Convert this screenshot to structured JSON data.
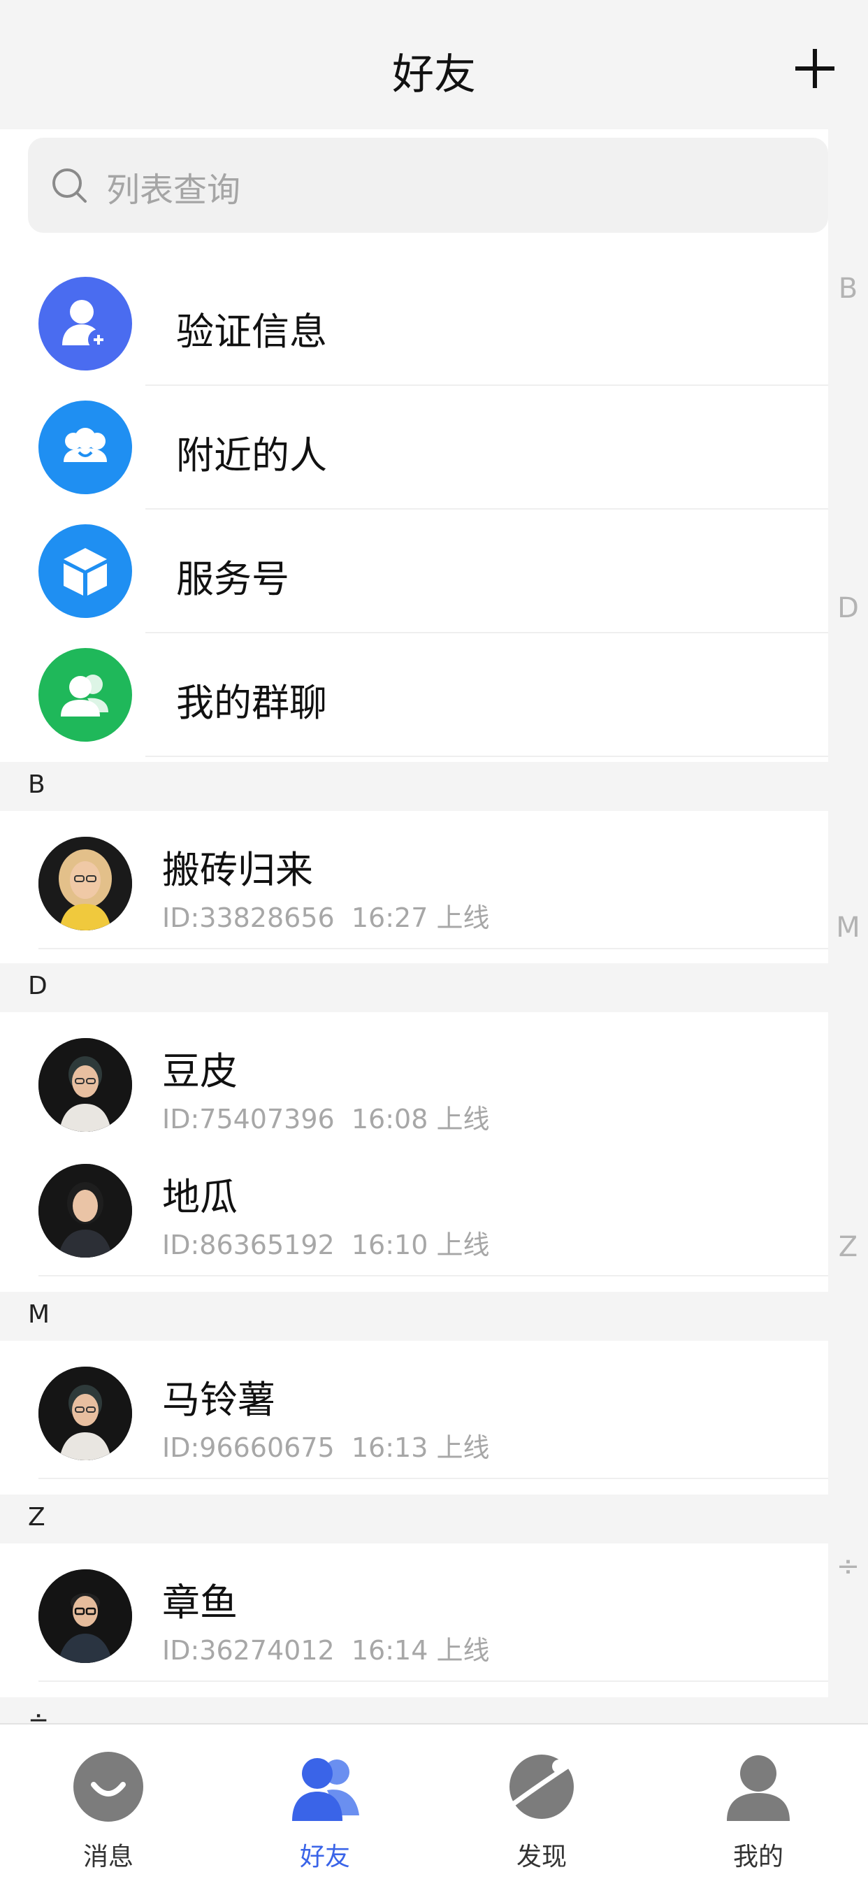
{
  "header": {
    "title": "好友"
  },
  "search": {
    "placeholder": "列表查询"
  },
  "functions": [
    {
      "label": "验证信息",
      "icon": "add-user-icon",
      "color": "#4a6cf0"
    },
    {
      "label": "附近的人",
      "icon": "nearby-people-icon",
      "color": "#1f8ff2"
    },
    {
      "label": "服务号",
      "icon": "cube-icon",
      "color": "#1f8ff2"
    },
    {
      "label": "我的群聊",
      "icon": "group-chat-icon",
      "color": "#1fb85a"
    }
  ],
  "sections": [
    {
      "letter": "B",
      "friends": [
        {
          "name": "搬砖归来",
          "id": "ID:33828656",
          "time": "16:27 上线"
        }
      ]
    },
    {
      "letter": "D",
      "friends": [
        {
          "name": "豆皮",
          "id": "ID:75407396",
          "time": "16:08 上线"
        },
        {
          "name": "地瓜",
          "id": "ID:86365192",
          "time": "16:10 上线"
        }
      ]
    },
    {
      "letter": "M",
      "friends": [
        {
          "name": "马铃薯",
          "id": "ID:96660675",
          "time": "16:13 上线"
        }
      ]
    },
    {
      "letter": "Z",
      "friends": [
        {
          "name": "章鱼",
          "id": "ID:36274012",
          "time": "16:14 上线"
        }
      ]
    },
    {
      "letter": "÷",
      "friends": []
    }
  ],
  "index": [
    "B",
    "D",
    "M",
    "Z",
    "÷"
  ],
  "tabs": [
    {
      "label": "消息",
      "icon": "message-icon",
      "active": false
    },
    {
      "label": "好友",
      "icon": "friends-icon",
      "active": true
    },
    {
      "label": "发现",
      "icon": "planet-icon",
      "active": false
    },
    {
      "label": "我的",
      "icon": "profile-icon",
      "active": false
    }
  ],
  "colors": {
    "accent": "#3a64e8",
    "inactive_tab": "#7c7c7c"
  }
}
